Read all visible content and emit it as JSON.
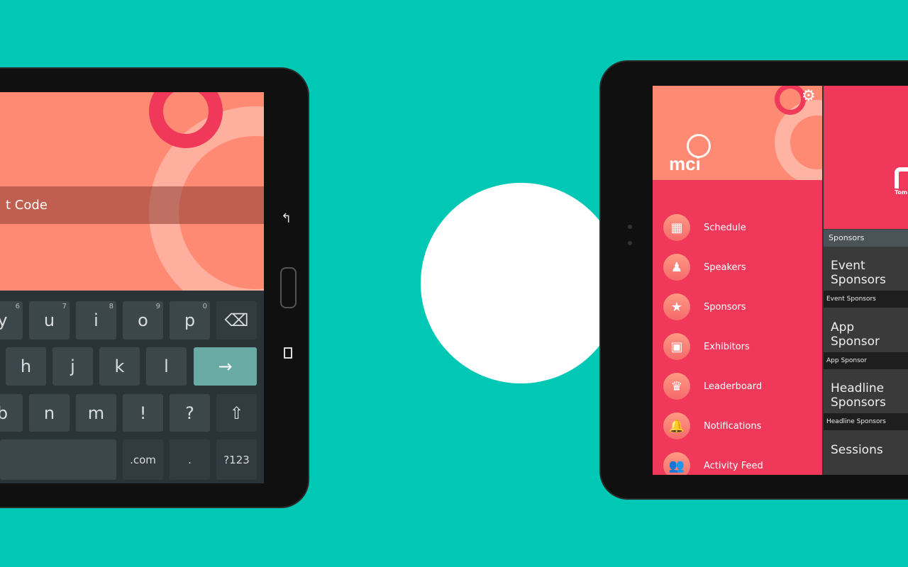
{
  "colors": {
    "background": "#00c8b5",
    "salmon": "#ff8a73",
    "red": "#f0395a",
    "keyboard": "#2a3438",
    "enter_key": "#6aaaa5"
  },
  "left_tablet": {
    "input_text": "t Code",
    "nav_icons": [
      "back-icon",
      "home-button",
      "recent-apps-icon"
    ],
    "keyboard": {
      "row1": [
        {
          "k": "y",
          "h": "6"
        },
        {
          "k": "u",
          "h": "7"
        },
        {
          "k": "i",
          "h": "8"
        },
        {
          "k": "o",
          "h": "9"
        },
        {
          "k": "p",
          "h": "0"
        },
        {
          "k": "⌫",
          "h": ""
        }
      ],
      "row2": [
        "h",
        "j",
        "k",
        "l",
        "→"
      ],
      "row3": [
        "b",
        "n",
        "m",
        "!",
        "?",
        "⇧"
      ],
      "row4": [
        ".com",
        ".",
        "?123"
      ]
    }
  },
  "right_tablet": {
    "logo": "mci",
    "settings_icon": "gear-icon",
    "menu": [
      {
        "label": "Schedule",
        "icon": "calendar-icon",
        "glyph": "▦"
      },
      {
        "label": "Speakers",
        "icon": "speaker-podium-icon",
        "glyph": "♟"
      },
      {
        "label": "Sponsors",
        "icon": "star-icon",
        "glyph": "★"
      },
      {
        "label": "Exhibitors",
        "icon": "booth-icon",
        "glyph": "▣"
      },
      {
        "label": "Leaderboard",
        "icon": "trophy-icon",
        "glyph": "♛"
      },
      {
        "label": "Notifications",
        "icon": "bell-icon",
        "glyph": "🔔"
      },
      {
        "label": "Activity Feed",
        "icon": "people-icon",
        "glyph": "👥"
      }
    ],
    "main": {
      "brand_partial": "Tom",
      "section_title": "Sponsors",
      "tiles": [
        {
          "big": "Event Sponsors",
          "label": "Event Sponsors"
        },
        {
          "big": "App Sponsor",
          "label": "App Sponsor"
        },
        {
          "big": "Headline Sponsors",
          "label": "Headline Sponsors"
        },
        {
          "big": "Sessions",
          "label": ""
        }
      ]
    }
  }
}
